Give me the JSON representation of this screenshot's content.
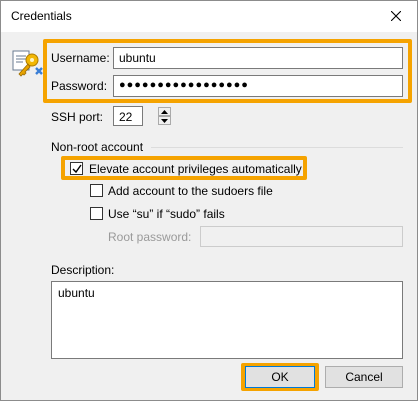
{
  "window": {
    "title": "Credentials"
  },
  "credentials": {
    "username_label": "Username:",
    "username_value": "ubuntu",
    "password_label": "Password:",
    "password_masked": "●●●●●●●●●●●●●●●●●",
    "ssh_port_label": "SSH port:",
    "ssh_port_value": "22"
  },
  "non_root": {
    "group_title": "Non-root account",
    "elevate_label": "Elevate account privileges automatically",
    "elevate_checked": true,
    "add_sudoers_label": "Add account to the sudoers file",
    "add_sudoers_checked": false,
    "use_su_label": "Use “su” if “sudo” fails",
    "use_su_checked": false,
    "root_password_label": "Root password:",
    "root_password_value": ""
  },
  "description": {
    "label": "Description:",
    "value": "ubuntu"
  },
  "buttons": {
    "ok": "OK",
    "cancel": "Cancel"
  },
  "colors": {
    "highlight": "#f5a300",
    "focus_blue": "#0078d7"
  },
  "icons": {
    "title_close": "close-icon",
    "credentials": "key-certificate-icon"
  }
}
